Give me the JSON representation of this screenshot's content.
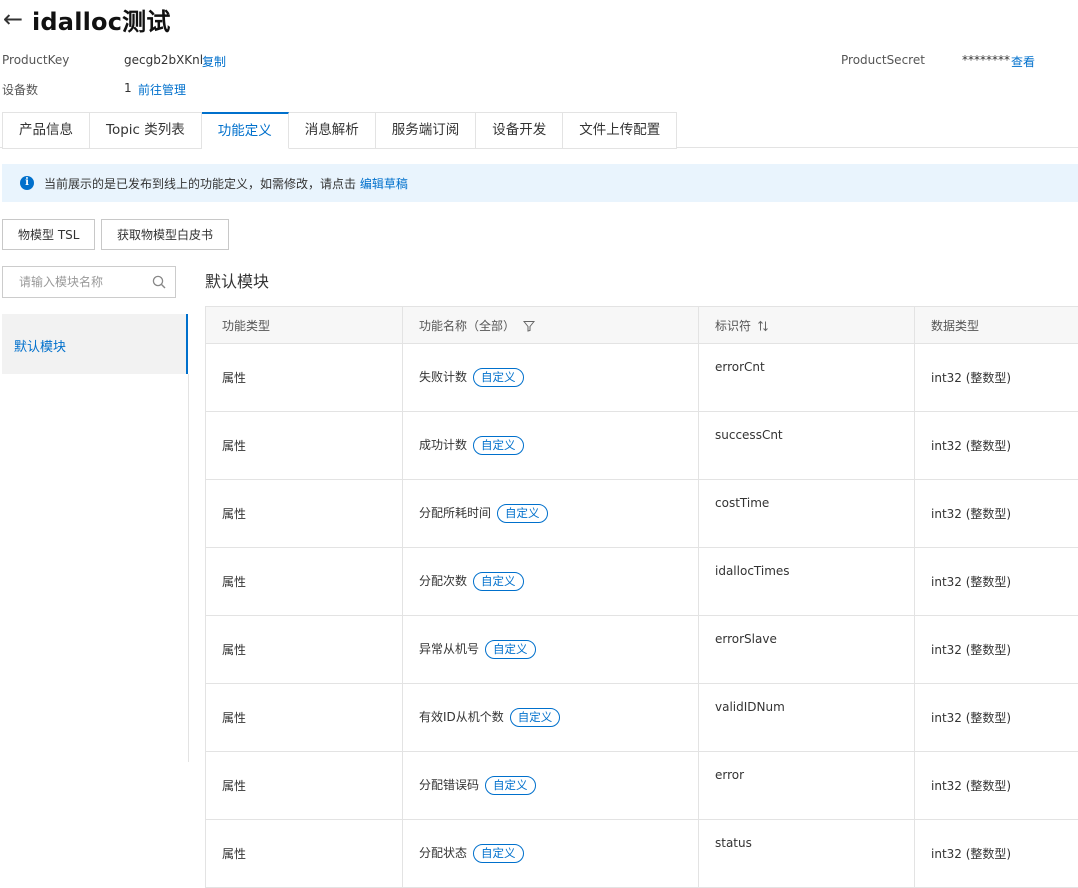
{
  "header": {
    "title": "idalloc测试",
    "product_key_label": "ProductKey",
    "product_key_value": "gecgb2bXKnl",
    "copy_label": "复制",
    "product_secret_label": "ProductSecret",
    "product_secret_value": "********",
    "view_label": "查看",
    "device_count_label": "设备数",
    "device_count_value": "1",
    "manage_label": "前往管理"
  },
  "tabs": [
    {
      "label": "产品信息"
    },
    {
      "label": "Topic 类列表"
    },
    {
      "label": "功能定义",
      "active": true
    },
    {
      "label": "消息解析"
    },
    {
      "label": "服务端订阅"
    },
    {
      "label": "设备开发"
    },
    {
      "label": "文件上传配置"
    }
  ],
  "notice": {
    "text": "当前展示的是已发布到线上的功能定义，如需修改，请点击",
    "link": "编辑草稿"
  },
  "toolbar": {
    "tsl_button": "物模型 TSL",
    "whitepaper_button": "获取物模型白皮书"
  },
  "sidebar": {
    "search_placeholder": "请输入模块名称",
    "modules": [
      {
        "label": "默认模块",
        "selected": true
      }
    ]
  },
  "main": {
    "module_title": "默认模块",
    "columns": [
      "功能类型",
      "功能名称（全部）",
      "标识符",
      "数据类型"
    ],
    "tag_label": "自定义",
    "rows": [
      {
        "type": "属性",
        "name": "失败计数",
        "identifier": "errorCnt",
        "data_type": "int32 (整数型)"
      },
      {
        "type": "属性",
        "name": "成功计数",
        "identifier": "successCnt",
        "data_type": "int32 (整数型)"
      },
      {
        "type": "属性",
        "name": "分配所耗时间",
        "identifier": "costTime",
        "data_type": "int32 (整数型)"
      },
      {
        "type": "属性",
        "name": "分配次数",
        "identifier": "idallocTimes",
        "data_type": "int32 (整数型)"
      },
      {
        "type": "属性",
        "name": "异常从机号",
        "identifier": "errorSlave",
        "data_type": "int32 (整数型)"
      },
      {
        "type": "属性",
        "name": "有效ID从机个数",
        "identifier": "validIDNum",
        "data_type": "int32 (整数型)"
      },
      {
        "type": "属性",
        "name": "分配错误码",
        "identifier": "error",
        "data_type": "int32 (整数型)"
      },
      {
        "type": "属性",
        "name": "分配状态",
        "identifier": "status",
        "data_type": "int32 (整数型)"
      }
    ]
  },
  "colors": {
    "accent": "#0070cc",
    "notice_bg": "#e9f4fd",
    "border": "#e3e3e3"
  },
  "icons": {
    "back": "arrow-left-icon",
    "info": "info-icon",
    "search": "search-icon",
    "filter": "filter-icon",
    "sort": "sort-icon"
  }
}
